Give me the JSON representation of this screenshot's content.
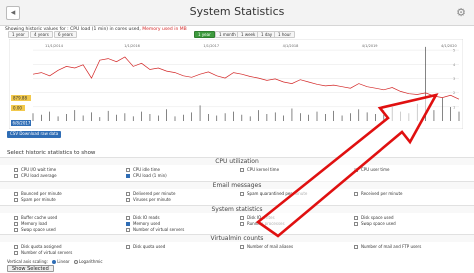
{
  "window": {
    "title": "System Statistics",
    "back_glyph": "◂",
    "settings_glyph": "⚙"
  },
  "legend": {
    "prefix": "Showing historic values for :",
    "cpu": "CPU load (1 min) in cores used,",
    "memory": "Memory used in MB"
  },
  "range_buttons": {
    "one_year": "1 year",
    "four_years": "4 years",
    "six_years": "6 years",
    "one_year_center": "1 year",
    "one_month": "1 month",
    "one_week": "1 week",
    "one_day": "1 day",
    "one_hour": "1 hour"
  },
  "chart_data": {
    "type": "line",
    "x_tick_labels": [
      "11/1/2014",
      "1/1/2016",
      "1/1/2017",
      "4/1/2018",
      "4/1/2019",
      "4/1/2020"
    ],
    "y_tick_labels": [
      "1",
      "2",
      "3",
      "4",
      "5"
    ],
    "value_labels": [
      "879.88",
      "0.00"
    ],
    "bottom_left_label": "6/8/2017",
    "series": [
      {
        "values": [
          60,
          62,
          58,
          65,
          70,
          68,
          72,
          55,
          78,
          80,
          76,
          82,
          70,
          74,
          66,
          68,
          64,
          62,
          58,
          56,
          60,
          63,
          58,
          55,
          62,
          60,
          57,
          55,
          52,
          54,
          50,
          48,
          53,
          50,
          47,
          45,
          46,
          44,
          42,
          48,
          44,
          42,
          40,
          43,
          38,
          35,
          34,
          36,
          32,
          30,
          33,
          28
        ]
      },
      {
        "values": [
          10,
          8,
          12,
          6,
          9,
          14,
          7,
          11,
          5,
          13,
          8,
          10,
          6,
          12,
          9,
          7,
          15,
          6,
          8,
          11,
          20,
          9,
          7,
          10,
          12,
          8,
          6,
          14,
          9,
          11,
          7,
          16,
          10,
          8,
          12,
          9,
          13,
          7,
          10,
          15,
          11,
          9,
          14,
          18,
          12,
          10,
          22,
          95,
          14,
          30,
          18,
          12
        ]
      }
    ],
    "colors": {
      "memory": "#d32727",
      "cpu": "#333333",
      "accent": "#2f6db5",
      "active": "#3d9a3d"
    }
  },
  "download_label": "CSV Download raw data",
  "stats_section_title": "Select historic statistics to show",
  "groups": {
    "cpu_title": "CPU utilization",
    "email_title": "Email messages",
    "system_title": "System statistics",
    "virtualmin_title": "Virtualmin counts"
  },
  "cpu_options": [
    "CPU I/O wait time",
    "CPU idle time",
    "CPU kernel time",
    "CPU user time",
    "CPU load average",
    "CPU load (1 min)"
  ],
  "email_options": [
    "Bounced per minute",
    "Delivered per minute",
    "Spam quarantined per minute",
    "Received per minute",
    "Spam per minute",
    "Viruses per minute"
  ],
  "system_options": [
    "Buffer cache used",
    "Disk IO reads",
    "Disk IO writes",
    "Disk space used",
    "Memory load",
    "Memory used",
    "Running processes",
    "Swap space used",
    "Swap space used",
    "Number of virtual servers"
  ],
  "virtualmin_options": [
    "Disk quota assigned",
    "Disk quota used",
    "Number of mail aliases",
    "Number of mail and FTP users",
    "Number of virtual servers"
  ],
  "scaling": {
    "label": "Vertical axis scaling:",
    "linear": "Linear",
    "log": "Logarithmic"
  },
  "show_button": "Show Selected"
}
